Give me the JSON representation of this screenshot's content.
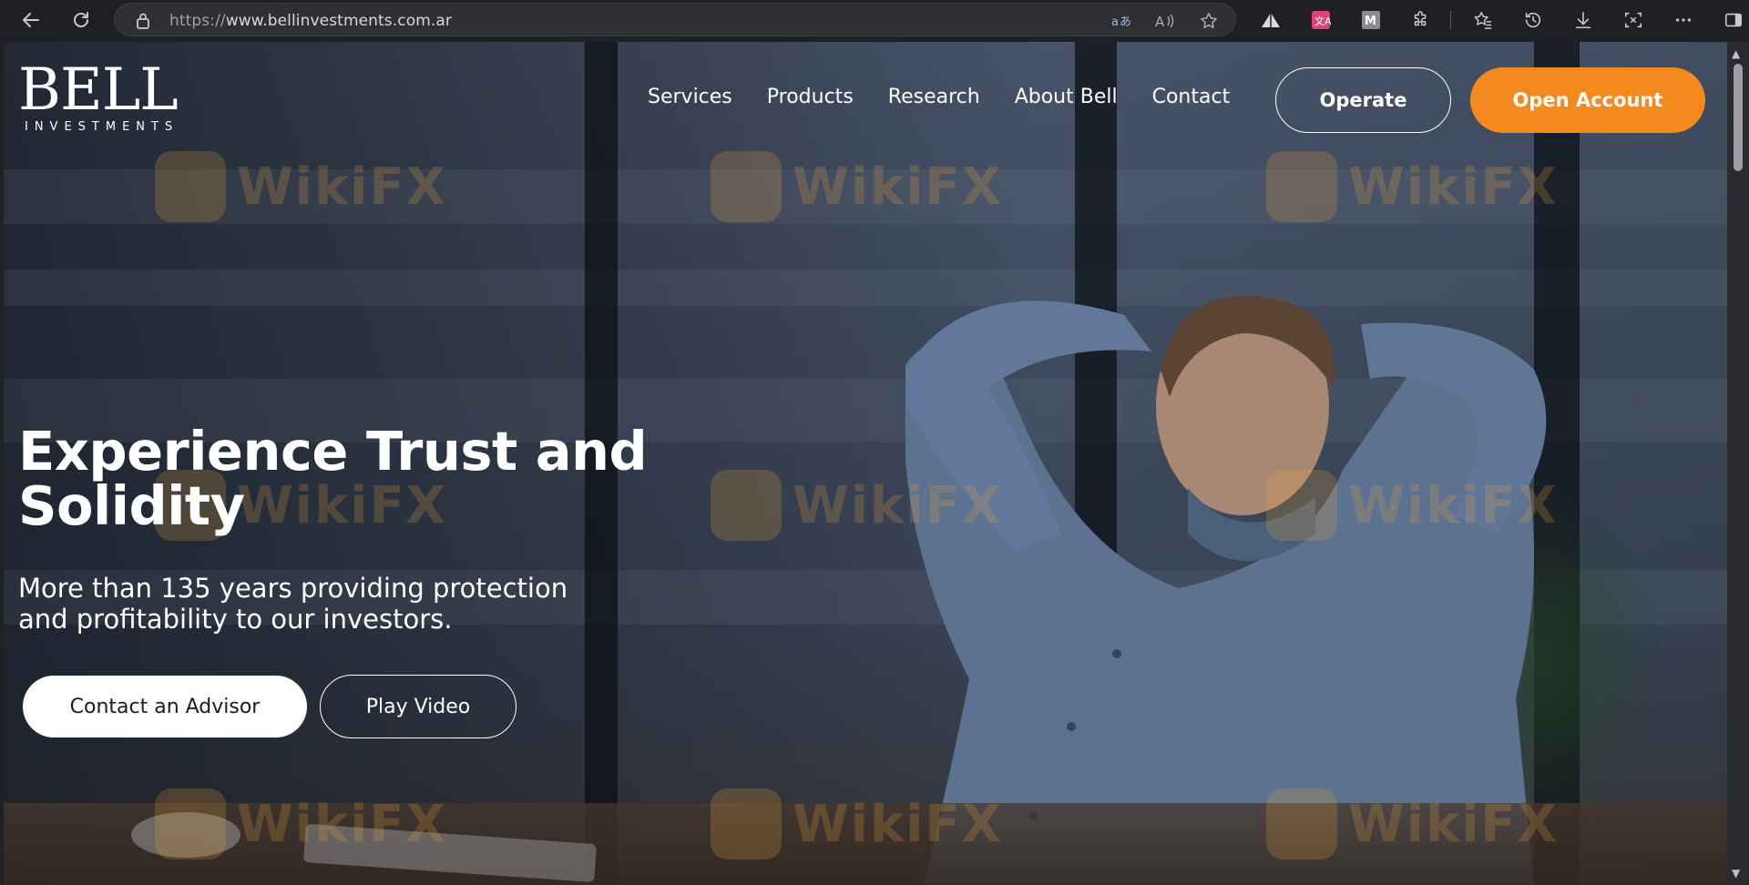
{
  "browser": {
    "url_scheme": "https://",
    "url_host": "www.bellinvestments.com.ar",
    "icons": {
      "back": "arrow-left-icon",
      "reload": "reload-icon",
      "lock": "lock-icon",
      "translate": "translate-icon",
      "read_aloud": "read-aloud-icon",
      "favorite": "star-icon",
      "toolbar": [
        "triangle-extension-icon",
        "translate-extension-icon",
        "m-extension-icon",
        "puzzle-icon",
        "favorites-icon",
        "history-icon",
        "download-icon",
        "screenshot-icon",
        "more-icon",
        "sidebar-icon"
      ]
    }
  },
  "site": {
    "logo": {
      "main": "BELL",
      "sub": "INVESTMENTS"
    },
    "nav": [
      {
        "label": "Services"
      },
      {
        "label": "Products"
      },
      {
        "label": "Research"
      },
      {
        "label": "About Bell"
      },
      {
        "label": "Contact"
      }
    ],
    "operate_label": "Operate",
    "open_account_label": "Open Account",
    "accent_color": "#f48a1e"
  },
  "hero": {
    "title": "Experience Trust and Solidity",
    "subtitle": "More than 135 years providing protection and profitability to our investors.",
    "advisor_label": "Contact an Advisor",
    "video_label": "Play Video"
  },
  "watermark": {
    "text": "WikiFX"
  }
}
